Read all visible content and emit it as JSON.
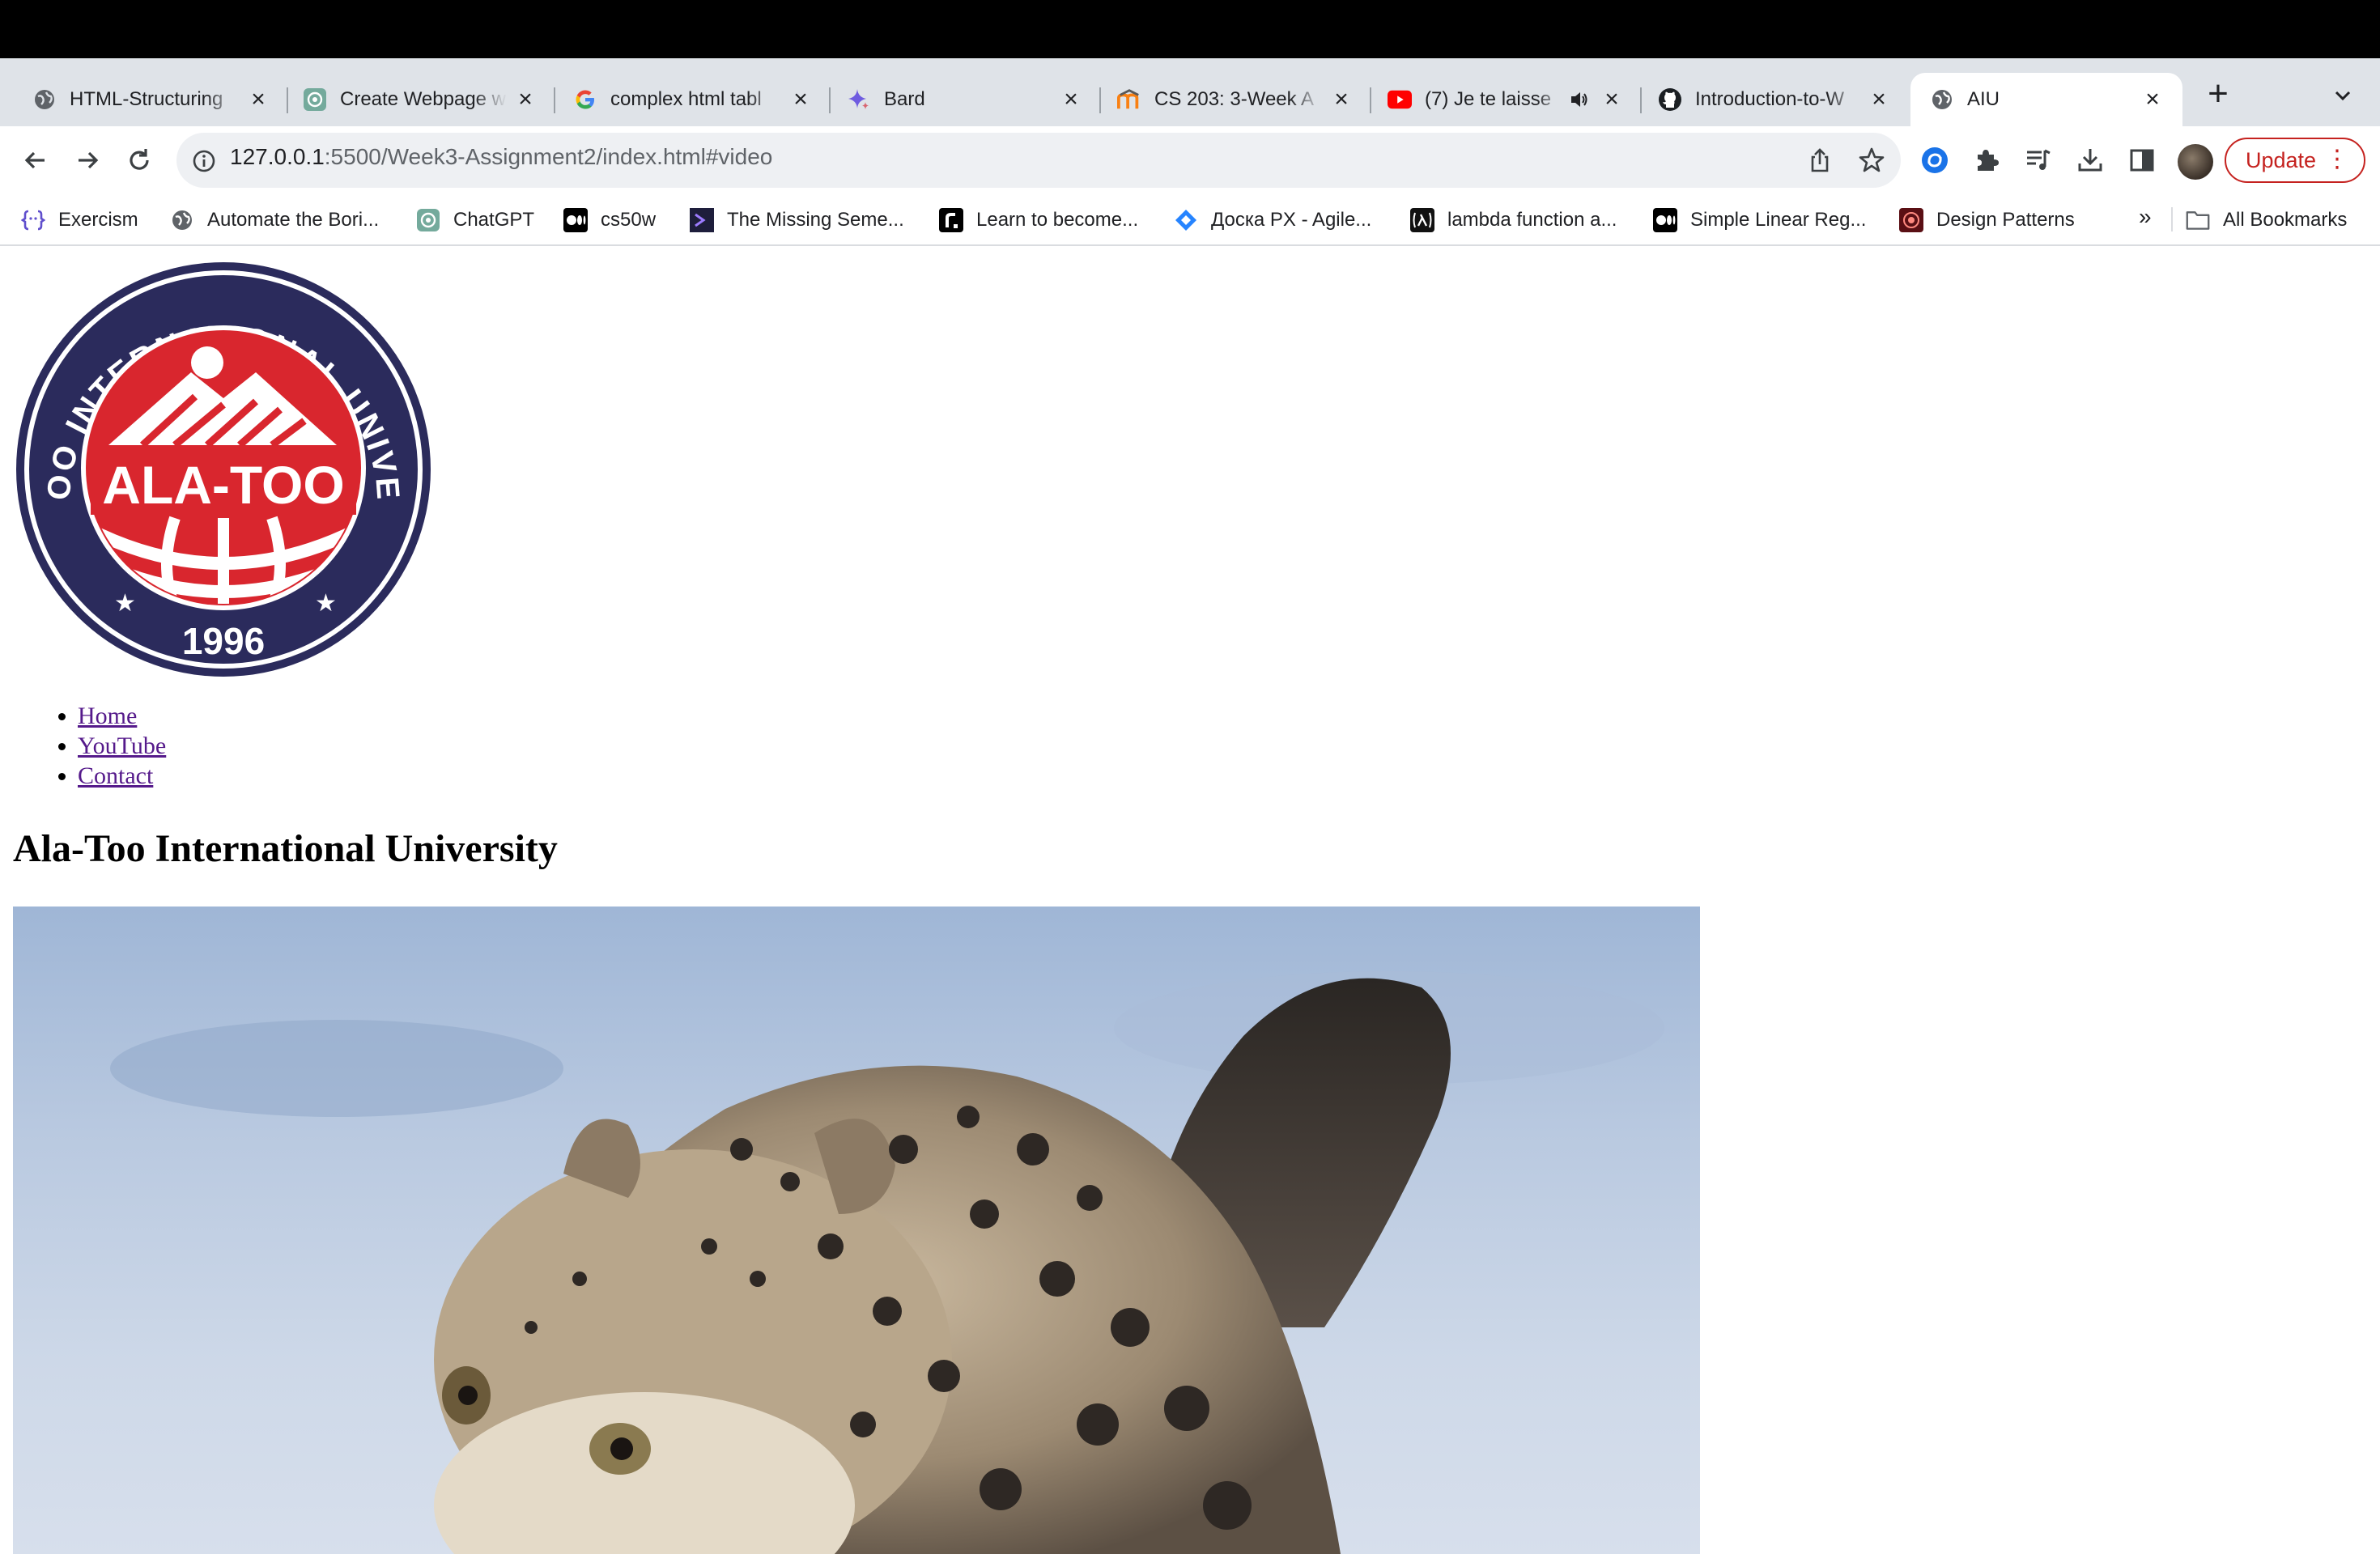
{
  "browser": {
    "tabs": [
      {
        "title": "HTML-Structuring",
        "icon": "globe-icon"
      },
      {
        "title": "Create Webpage w",
        "icon": "chatgpt-icon"
      },
      {
        "title": "complex html tabl",
        "icon": "google-icon"
      },
      {
        "title": "Bard",
        "icon": "bard-icon"
      },
      {
        "title": "CS 203: 3-Week A",
        "icon": "moodle-icon"
      },
      {
        "title": "(7) Je te laisse",
        "icon": "youtube-icon",
        "audio": true
      },
      {
        "title": "Introduction-to-W",
        "icon": "github-icon"
      },
      {
        "title": "AIU",
        "icon": "globe-icon",
        "active": true
      }
    ],
    "address": {
      "host": "127.0.0.1",
      "path": ":5500/Week3-Assignment2/index.html#video"
    },
    "update_label": "Update",
    "bookmarks": [
      {
        "label": "Exercism",
        "icon": "exercism-icon"
      },
      {
        "label": "Automate the Bori...",
        "icon": "globe-icon"
      },
      {
        "label": "ChatGPT",
        "icon": "chatgpt-icon"
      },
      {
        "label": "cs50w",
        "icon": "medium-icon"
      },
      {
        "label": "The Missing Seme...",
        "icon": "terminal-icon"
      },
      {
        "label": "Learn to become...",
        "icon": "roadmap-icon"
      },
      {
        "label": "Доска PX - Agile...",
        "icon": "jira-icon"
      },
      {
        "label": "lambda function a...",
        "icon": "lambda-icon"
      },
      {
        "label": "Simple Linear Reg...",
        "icon": "medium-icon"
      },
      {
        "label": "Design Patterns",
        "icon": "design-patterns-icon"
      }
    ],
    "bookmarks_more": "»",
    "all_bookmarks": "All Bookmarks"
  },
  "page": {
    "logo": {
      "arc_text": "ALA-TOO INTERNATIONAL UNIVERSITY",
      "center_text": "ALA-TOO",
      "year": "1996"
    },
    "nav": [
      "Home",
      "YouTube",
      "Contact"
    ],
    "title": "Ala-Too International University"
  },
  "colors": {
    "tabstrip": "#dfe3e8",
    "logo_navy": "#2b2b5c",
    "logo_red": "#d9262e",
    "visited_link": "#551a8b",
    "update_red": "#c5221f"
  }
}
